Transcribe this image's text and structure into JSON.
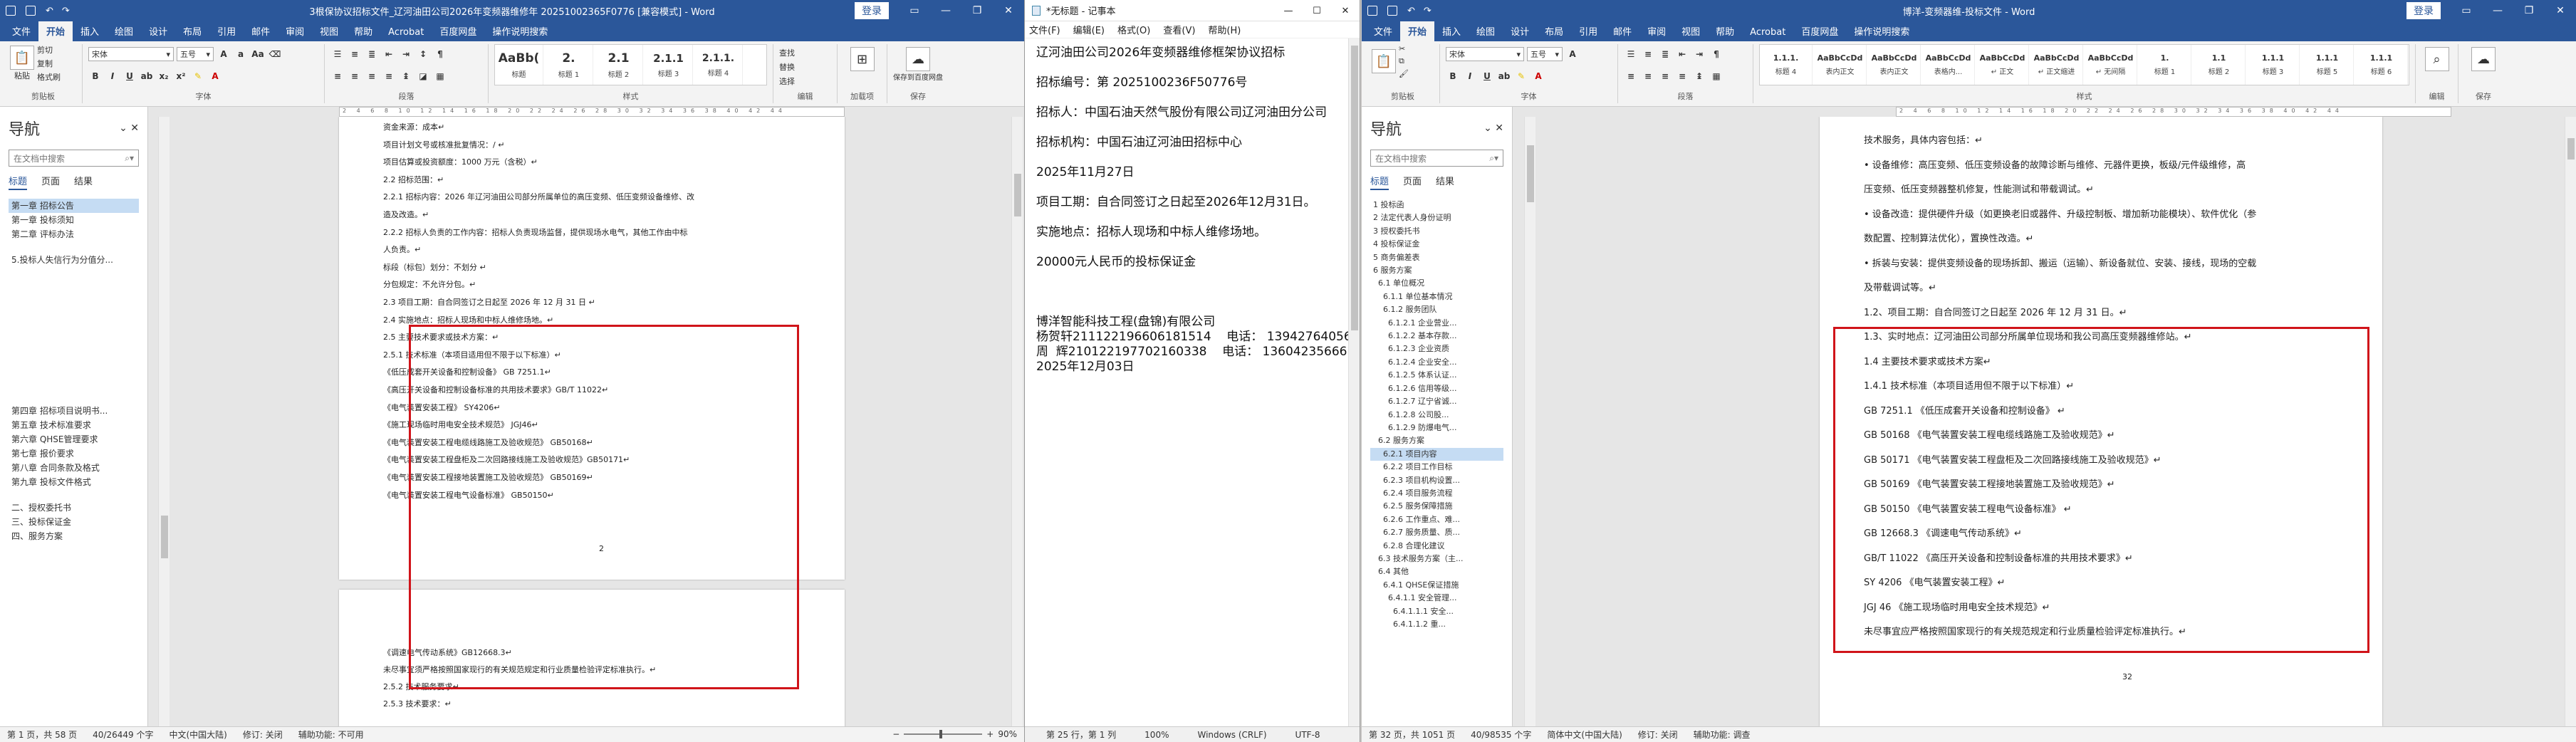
{
  "left_word": {
    "title": "3根保协议招标文件_辽河油田公司2026年变频器维修年 20251002365F0776 [兼容模式] - Word",
    "login": "登录",
    "tabs": [
      "文件",
      "开始",
      "插入",
      "绘图",
      "设计",
      "布局",
      "引用",
      "邮件",
      "审阅",
      "视图",
      "帮助",
      "Acrobat",
      "百度网盘",
      "操作说明搜索"
    ],
    "font_name": "宋体",
    "font_size": "五号",
    "styles": [
      {
        "preview": "AaBb(",
        "name": "标题"
      },
      {
        "preview": "2.",
        "name": "标题 1"
      },
      {
        "preview": "2.1",
        "name": "标题 2"
      },
      {
        "preview": "2.1.1",
        "name": "标题 3"
      },
      {
        "preview": "2.1.1.",
        "name": "标题 4"
      }
    ],
    "groups": [
      "剪贴板",
      "字体",
      "段落",
      "样式",
      "编辑",
      "加载项",
      "保存"
    ],
    "clipboard": {
      "paste": "粘贴",
      "cut": "剪切",
      "copy": "复制",
      "painter": "格式刷"
    },
    "edit": {
      "find": "查找",
      "replace": "替换",
      "select": "选择"
    },
    "save_baidu": "保存到百度网盘",
    "addin": "加载项",
    "nav": {
      "title": "导航",
      "search": "在文档中搜索",
      "tabs": [
        "标题",
        "页面",
        "结果"
      ],
      "items": [
        "第一章 招标公告",
        "第一章 投标须知",
        "第二章 评标办法",
        "",
        "5.投标人失信行为分值分...",
        "",
        "",
        "",
        "",
        "",
        "",
        "",
        "",
        "",
        "",
        "",
        "",
        "第四章 招标项目说明书...",
        "第五章 技术标准要求",
        "第六章 QHSE管理要求",
        "第七章 报价要求",
        "第八章 合同条款及格式",
        "第九章 投标文件格式",
        "",
        "二、授权委托书",
        "三、投标保证金",
        "四、服务方案"
      ]
    },
    "doc_lines": [
      "资金来源：成本↵",
      "项目计划文号或核准批复情况：/ ↵",
      "项目估算或投资额度：1000 万元（含税）↵",
      "2.2 招标范围：↵",
      "2.2.1 招标内容：2026 年辽河油田公司部分所属单位的高压变频、低压变频设备维修、改",
      "造及改造。↵",
      "2.2.2 招标人负责的工作内容：招标人负责现场监督，提供现场水电气，其他工作由中标",
      "人负责。↵",
      "标段（标包）划分：不划分 ↵",
      "分包规定：不允许分包。↵",
      "2.3 项目工期：自合同签订之日起至 2026 年 12 月 31 日 ↵",
      "2.4 实施地点：招标人现场和中标人维修场地。↵",
      "2.5 主要技术要求或技术方案：↵",
      "2.5.1 技术标准（本项目适用但不限于以下标准）↵",
      "《低压成套开关设备和控制设备》 GB 7251.1↵",
      "《高压开关设备和控制设备标准的共用技术要求》GB/T 11022↵",
      "《电气装置安装工程》  SY4206↵",
      "《施工现场临时用电安全技术规范》 JGJ46↵",
      "《电气装置安装工程电缆线路施工及验收规范》 GB50168↵",
      "《电气装置安装工程盘柜及二次回路接线施工及验收规范》GB50171↵",
      "《电气装置安装工程接地装置施工及验收规范》 GB50169↵",
      "《电气装置安装工程电气设备标准》 GB50150↵"
    ],
    "page_number": "2",
    "doc_lines_page2": [
      "《调速电气传动系统》GB12668.3↵",
      "未尽事宜须严格按照国家现行的有关规范规定和行业质量检验评定标准执行。↵",
      "2.5.2 技术服务要求↵",
      "2.5.3 技术要求：↵"
    ],
    "status": {
      "page": "第 1 页，共 58 页",
      "words": "40/26449 个字",
      "lang": "中文(中国大陆)",
      "track": "修订: 关闭",
      "access": "辅助功能: 不可用",
      "zoom": "90%"
    }
  },
  "notepad": {
    "title": "*无标题 - 记事本",
    "menu": [
      "文件(F)",
      "编辑(E)",
      "格式(O)",
      "查看(V)",
      "帮助(H)"
    ],
    "lines": [
      "辽河油田公司2026年变频器维修框架协议招标",
      "",
      "招标编号：第 2025100236F50776号",
      "",
      "招标人：中国石油天然气股份有限公司辽河油田分公司",
      "",
      "招标机构：中国石油辽河油田招标中心",
      "",
      "2025年11月27日",
      "",
      "项目工期：自合同签订之日起至2026年12月31日。",
      "",
      "实施地点：招标人现场和中标人维修场地。",
      "",
      "20000元人民币的投标保证金",
      "",
      "",
      "",
      "博洋智能科技工程(盘锦)有限公司",
      "杨贺轩211122196606181514    电话： 13942764056",
      "周  辉210122197702160338    电话： 13604235666",
      "2025年12月03日"
    ],
    "status": {
      "pos": "第 25 行，第 1 列",
      "zoom": "100%",
      "eol": "Windows (CRLF)",
      "enc": "UTF-8"
    }
  },
  "right_word": {
    "title": "博洋-变频器维-投标文件 - Word",
    "login": "登录",
    "tabs": [
      "文件",
      "开始",
      "插入",
      "绘图",
      "设计",
      "布局",
      "引用",
      "邮件",
      "审阅",
      "视图",
      "帮助",
      "Acrobat",
      "百度网盘",
      "操作说明搜索"
    ],
    "font_name": "宋体",
    "font_size": "五号",
    "styles": [
      {
        "preview": "1.1.1.",
        "name": "标题 4"
      },
      {
        "preview": "AaBbCcDd",
        "name": "表内正文"
      },
      {
        "preview": "AaBbCcDd",
        "name": "表内正文"
      },
      {
        "preview": "AaBbCcDd",
        "name": "表格内..."
      },
      {
        "preview": "AaBbCcDd",
        "name": "↵ 正文"
      },
      {
        "preview": "AaBbCcDd",
        "name": "↵ 正文缩进"
      },
      {
        "preview": "AaBbCcDd",
        "name": "↵ 无间隔"
      },
      {
        "preview": "1.",
        "name": "标题 1"
      },
      {
        "preview": "1.1",
        "name": "标题 2"
      },
      {
        "preview": "1.1.1",
        "name": "标题 3"
      },
      {
        "preview": "1.1.1",
        "name": "标题 5"
      },
      {
        "preview": "1.1.1",
        "name": "标题 6"
      }
    ],
    "groups": [
      "剪贴板",
      "字体",
      "段落",
      "样式",
      "编辑",
      "保存"
    ],
    "nav": {
      "title": "导航",
      "search": "在文档中搜索",
      "tabs": [
        "标题",
        "页面",
        "结果"
      ],
      "items": [
        "1 投标函",
        "2 法定代表人身份证明",
        "3 授权委托书",
        "4 投标保证金",
        "5 商务偏差表",
        "6 服务方案",
        "  6.1 单位概况",
        "    6.1.1 单位基本情况",
        "    6.1.2 服务团队",
        "      6.1.2.1 企业营业...",
        "      6.1.2.2 基本存款...",
        "      6.1.2.3 企业资质",
        "      6.1.2.4 企业安全...",
        "      6.1.2.5 体系认证...",
        "      6.1.2.6 信用等级...",
        "      6.1.2.7 辽宁省诚...",
        "      6.1.2.8 公司股...",
        "      6.1.2.9 防爆电气...",
        "  6.2 服务方案",
        "    6.2.1 项目内容",
        "    6.2.2 项目工作目标",
        "    6.2.3 项目机构设置...",
        "    6.2.4 项目服务流程",
        "    6.2.5 服务保障措施",
        "    6.2.6 工作重点、难...",
        "    6.2.7 服务质量、质...",
        "    6.2.8 合理化建议",
        "  6.3 技术服务方案（主...",
        "  6.4 其他",
        "    6.4.1 QHSE保证措施",
        "      6.4.1.1 安全管理...",
        "        6.4.1.1.1 安全...",
        "        6.4.1.1.2 重..."
      ]
    },
    "doc_lines": [
      "技术服务，具体内容包括：↵",
      "  • 设备维修：高压变频、低压变频设备的故障诊断与维修、元器件更换，板级/元件级维修，高",
      "压变频、低压变频器整机修复，性能测试和带载调试。↵",
      "  • 设备改造：提供硬件升级（如更换老旧或器件、升级控制板、增加新功能模块）、软件优化（参",
      "数配置、控制算法优化），置换性改造。↵",
      "  • 拆装与安装：提供变频设备的现场拆卸、搬运（运输）、新设备就位、安装、接线，现场的空载",
      "及带载调试等。↵",
      "1.2、项目工期：自合同签订之日起至 2026 年 12 月 31 日。↵",
      "1.3、实时地点：辽河油田公司部分所属单位现场和我公司高压变频器维修站。↵",
      "1.4 主要技术要求或技术方案↵",
      "1.4.1 技术标准（本项目适用但不限于以下标准）↵",
      "GB 7251.1    《低压成套开关设备和控制设备》 ↵",
      "GB 50168     《电气装置安装工程电缆线路施工及验收规范》↵",
      "GB 50171     《电气装置安装工程盘柜及二次回路接线施工及验收规范》↵",
      "GB 50169     《电气装置安装工程接地装置施工及验收规范》↵",
      "GB 50150     《电气装置安装工程电气设备标准》 ↵",
      "GB 12668.3  《调速电气传动系统》↵",
      "GB/T 11022  《高压开关设备和控制设备标准的共用技术要求》↵",
      "SY 4206      《电气装置安装工程》↵",
      "JGJ 46       《施工现场临时用电安全技术规范》↵",
      "未尽事宜应严格按照国家现行的有关规范规定和行业质量检验评定标准执行。↵"
    ],
    "page_number": "32",
    "status": {
      "page": "第 32 页，共 1051 页",
      "words": "40/98535 个字",
      "lang": "简体中文(中国大陆)",
      "track": "修订: 关闭",
      "access": "辅助功能: 调查"
    }
  }
}
